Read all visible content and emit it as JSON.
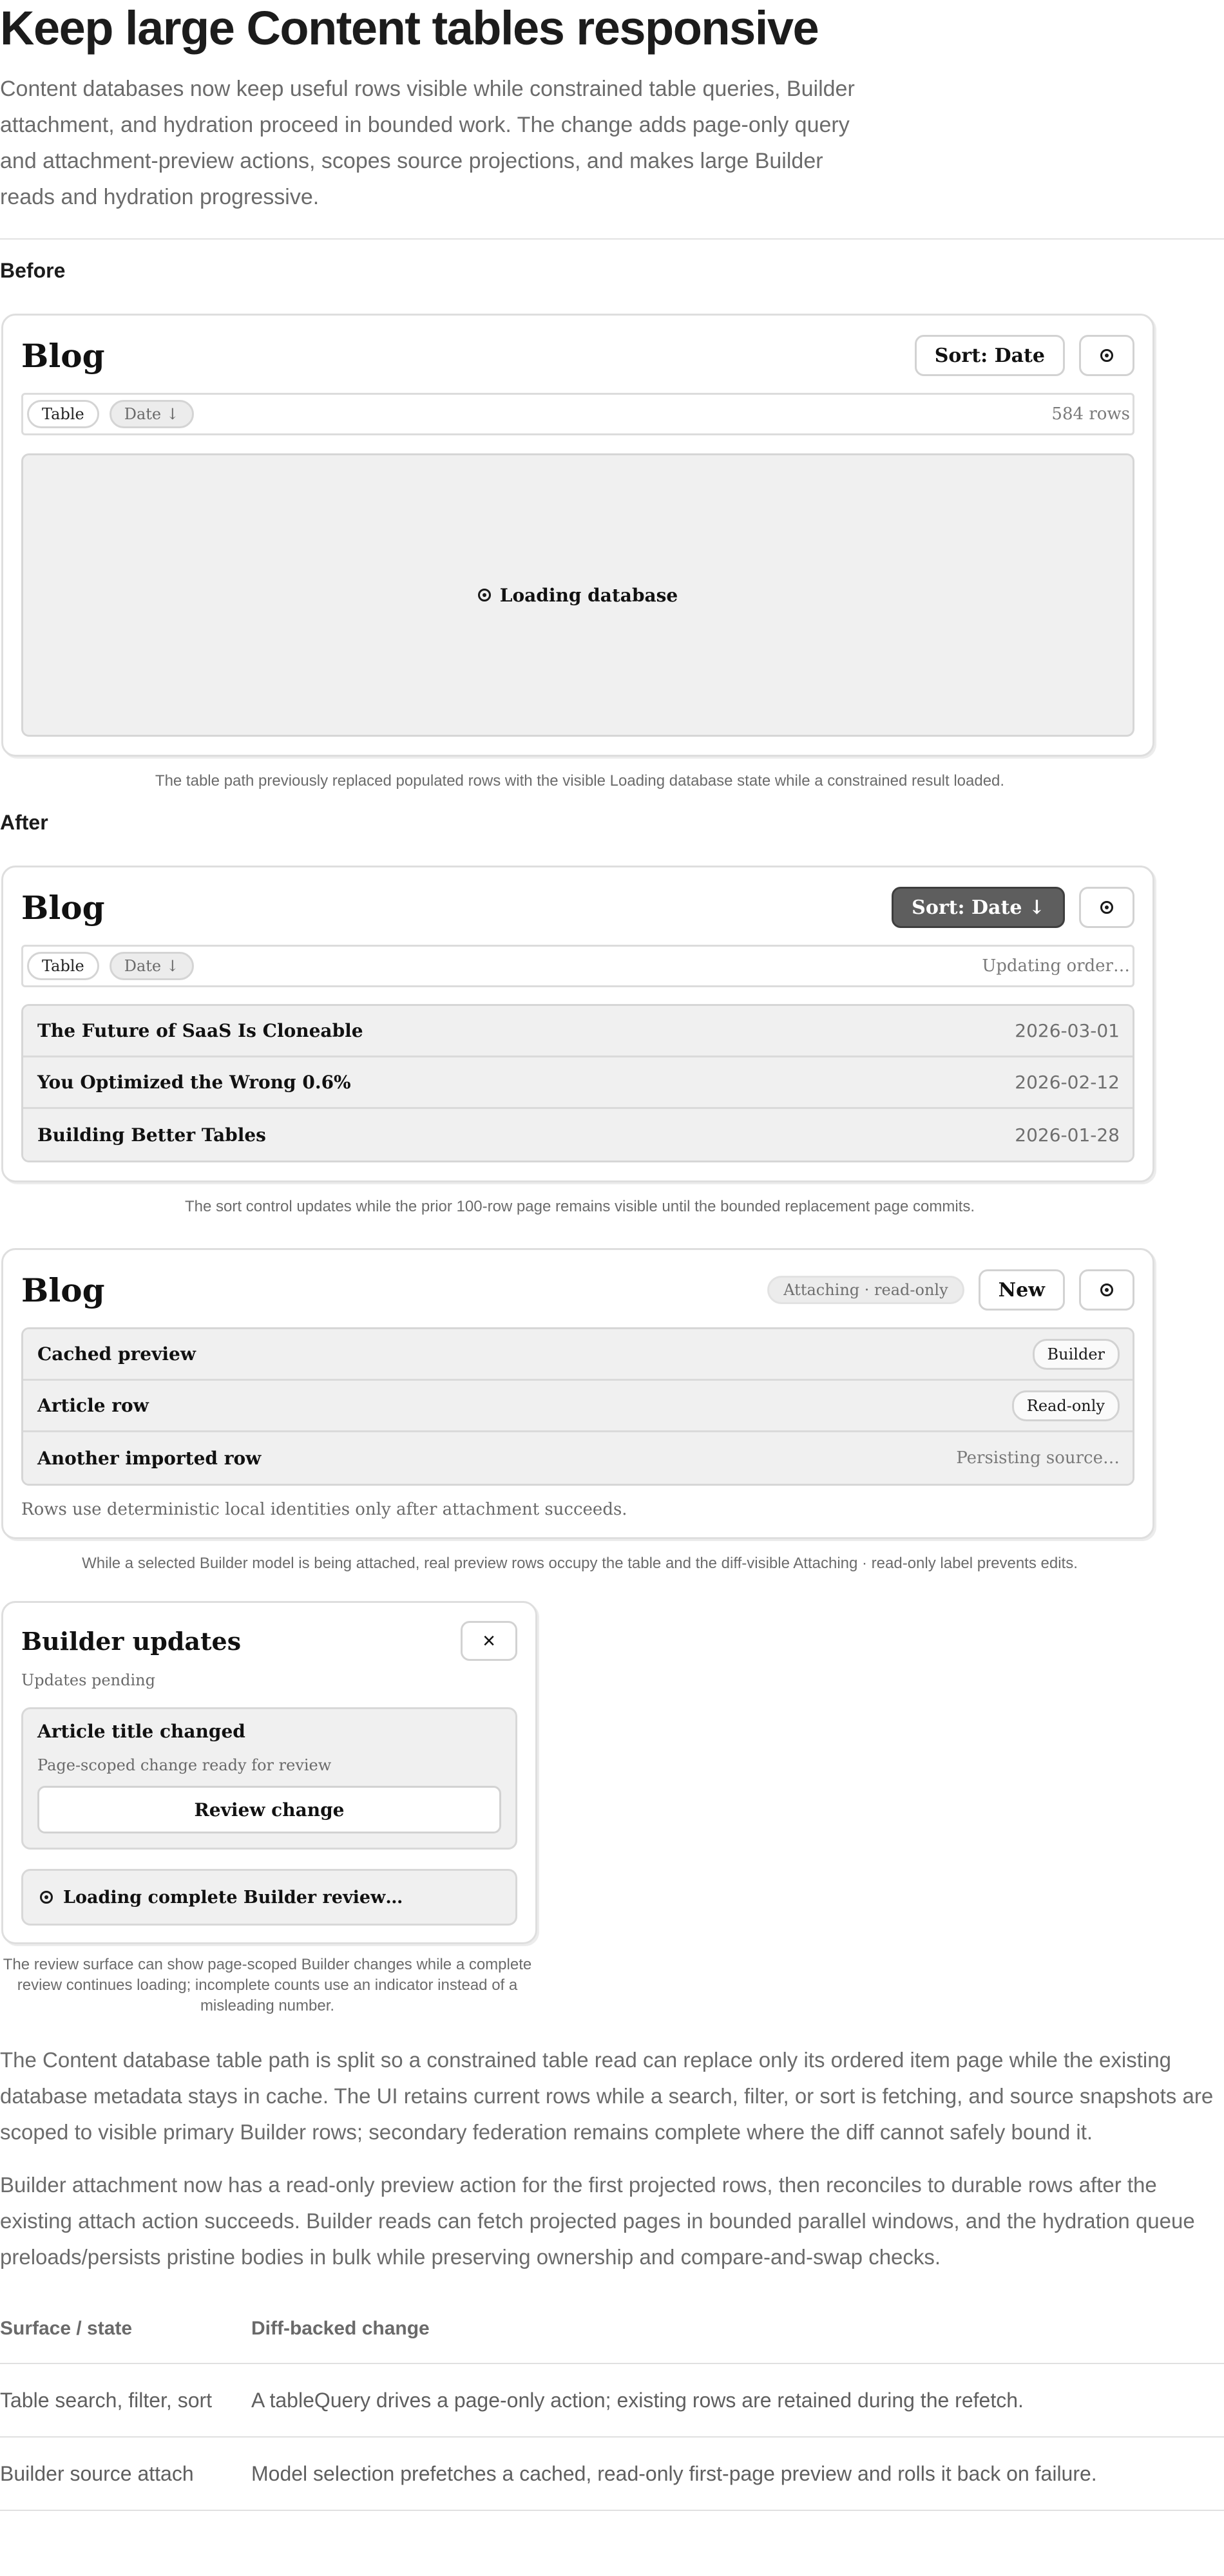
{
  "title": "Keep large Content tables responsive",
  "intro": "Content databases now keep useful rows visible while constrained table queries, Builder attachment, and hydration proceed in bounded work. The change adds page-only query and attachment-preview actions, scopes source projections, and makes large Builder reads and hydration progressive.",
  "before": {
    "label": "Before",
    "card_title": "Blog",
    "sort_button": "Sort: Date",
    "chip_table": "Table",
    "chip_date": "Date ↓",
    "row_count": "584 rows",
    "loading_text": "Loading database",
    "caption": "The table path previously replaced populated rows with the visible Loading database state while a constrained result loaded."
  },
  "after": {
    "label": "After",
    "card_title": "Blog",
    "sort_button": "Sort: Date ↓",
    "chip_table": "Table",
    "chip_date": "Date ↓",
    "status": "Updating order…",
    "rows": [
      {
        "title": "The Future of SaaS Is Cloneable",
        "date": "2026-03-01"
      },
      {
        "title": "You Optimized the Wrong 0.6%",
        "date": "2026-02-12"
      },
      {
        "title": "Building Better Tables",
        "date": "2026-01-28"
      }
    ],
    "caption": "The sort control updates while the prior 100-row page remains visible until the bounded replacement page commits."
  },
  "attach": {
    "card_title": "Blog",
    "status_pill": "Attaching · read-only",
    "new_button": "New",
    "rows": [
      {
        "title": "Cached preview",
        "badge": "Builder"
      },
      {
        "title": "Article row",
        "badge": "Read-only"
      },
      {
        "title": "Another imported row",
        "status": "Persisting source…"
      }
    ],
    "note": "Rows use deterministic local identities only after attachment succeeds.",
    "caption": "While a selected Builder model is being attached, real preview rows occupy the table and the diff-visible Attaching · read-only label prevents edits."
  },
  "builder_panel": {
    "title": "Builder updates",
    "close_label": "×",
    "subtitle": "Updates pending",
    "change_title": "Article title changed",
    "change_desc": "Page-scoped change ready for review",
    "review_button": "Review change",
    "loading_text": "Loading complete Builder review…",
    "caption": "The review surface can show page-scoped Builder changes while a complete review continues loading; incomplete counts use an indicator instead of a misleading number."
  },
  "paragraphs": [
    "The Content database table path is split so a constrained table read can replace only its ordered item page while the existing database metadata stays in cache. The UI retains current rows while a search, filter, or sort is fetching, and source snapshots are scoped to visible primary Builder rows; secondary federation remains complete where the diff cannot safely bound it.",
    "Builder attachment now has a read-only preview action for the first projected rows, then reconciles to durable rows after the existing attach action succeeds. Builder reads can fetch projected pages in bounded parallel windows, and the hydration queue preloads/persists pristine bodies in bulk while preserving ownership and compare-and-swap checks."
  ],
  "table": {
    "headers": [
      "Surface / state",
      "Diff-backed change"
    ],
    "rows": [
      [
        "Table search, filter, sort",
        "A tableQuery drives a page-only action; existing rows are retained during the refetch."
      ],
      [
        "Builder source attach",
        "Model selection prefetches a cached, read-only first-page preview and rolls it back on failure."
      ]
    ]
  },
  "icons": {
    "target": "target-icon",
    "close": "close-icon"
  }
}
